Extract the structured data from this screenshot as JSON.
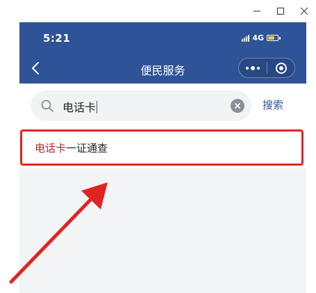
{
  "window": {
    "controls": [
      "minimize-icon",
      "maximize-icon",
      "close-icon"
    ]
  },
  "status_bar": {
    "time": "5:21",
    "network": "4G",
    "icons": [
      "signal-icon",
      "battery-icon"
    ]
  },
  "nav": {
    "title": "便民服务",
    "back_icon": "chevron-left-icon",
    "capsule_icons": [
      "more-dots-icon",
      "target-close-icon"
    ]
  },
  "search": {
    "value": "电话卡",
    "button_label": "搜索",
    "icons": [
      "search-icon",
      "clear-icon"
    ]
  },
  "results": [
    {
      "highlight": "电话卡",
      "rest": "一证通查"
    }
  ],
  "annotation": {
    "highlight_color": "#e02424",
    "arrow_color": "#e02424"
  },
  "colors": {
    "brand": "#2e5396",
    "match_text": "#b8242a"
  }
}
